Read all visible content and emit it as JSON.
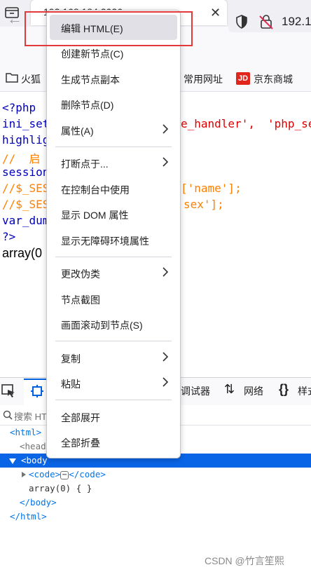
{
  "browser": {
    "tab_title": "192.168.184.2026",
    "tab_close": "✕",
    "new_tab": "+",
    "back": "←",
    "url_text": "192.1",
    "bookmarks": [
      {
        "label": "火狐"
      },
      {
        "label": "常用网址"
      },
      {
        "label": "京东商城"
      }
    ],
    "jd_logo_text": "JD"
  },
  "page": {
    "code_lines": [
      {
        "text": "<?php",
        "color": "blue"
      },
      {
        "text": "ini_set",
        "color": "blue"
      },
      {
        "text": "highlig",
        "color": "blue"
      },
      {
        "text": "//  启",
        "color": "orange"
      },
      {
        "text": "session",
        "color": "blue"
      },
      {
        "text": "//$_SES",
        "color": "orange"
      },
      {
        "text": "//$_SES",
        "color": "orange"
      },
      {
        "text": "var_dum",
        "color": "blue"
      },
      {
        "text": "?>",
        "color": "blue"
      }
    ],
    "code_fragments": [
      {
        "text": "e_handler',",
        "color": "red"
      },
      {
        "text": "'php_se",
        "color": "red"
      },
      {
        "text": "['name'];",
        "color": "orange"
      },
      {
        "text": "sex'];",
        "color": "orange"
      }
    ],
    "output": "array(0"
  },
  "devtools": {
    "debugger_label": "调试器",
    "network_label": "网络",
    "style_label": "样式",
    "search_placeholder": "搜索 HT",
    "tree": {
      "html_open": "<html>",
      "head": "<head",
      "body_open": "body",
      "code_open": "<code>",
      "code_close": "</code>",
      "array_text": "array(0) { }",
      "body_close": "</body>",
      "html_close": "</html>",
      "ellipsis": "⋯"
    }
  },
  "context_menu": {
    "items": [
      {
        "label": "编辑 HTML(E)",
        "submenu": false,
        "highlighted": true
      },
      {
        "label": "创建新节点(C)",
        "submenu": false
      },
      {
        "label": "生成节点副本",
        "submenu": false
      },
      {
        "label": "删除节点(D)",
        "submenu": false
      },
      {
        "label": "属性(A)",
        "submenu": true
      },
      {
        "label": "打断点于...",
        "submenu": true
      },
      {
        "label": "在控制台中使用",
        "submenu": false
      },
      {
        "label": "显示 DOM 属性",
        "submenu": false
      },
      {
        "label": "显示无障碍环境属性",
        "submenu": false
      },
      {
        "label": "更改伪类",
        "submenu": true
      },
      {
        "label": "节点截图",
        "submenu": false
      },
      {
        "label": "画面滚动到节点(S)",
        "submenu": false
      },
      {
        "label": "复制",
        "submenu": true
      },
      {
        "label": "粘贴",
        "submenu": true
      },
      {
        "label": "全部展开",
        "submenu": false
      },
      {
        "label": "全部折叠",
        "submenu": false
      }
    ]
  },
  "watermark": "CSDN @竹言笙熙",
  "colors": {
    "accent": "#0a64e6",
    "highlight_border": "#e23a3a"
  }
}
